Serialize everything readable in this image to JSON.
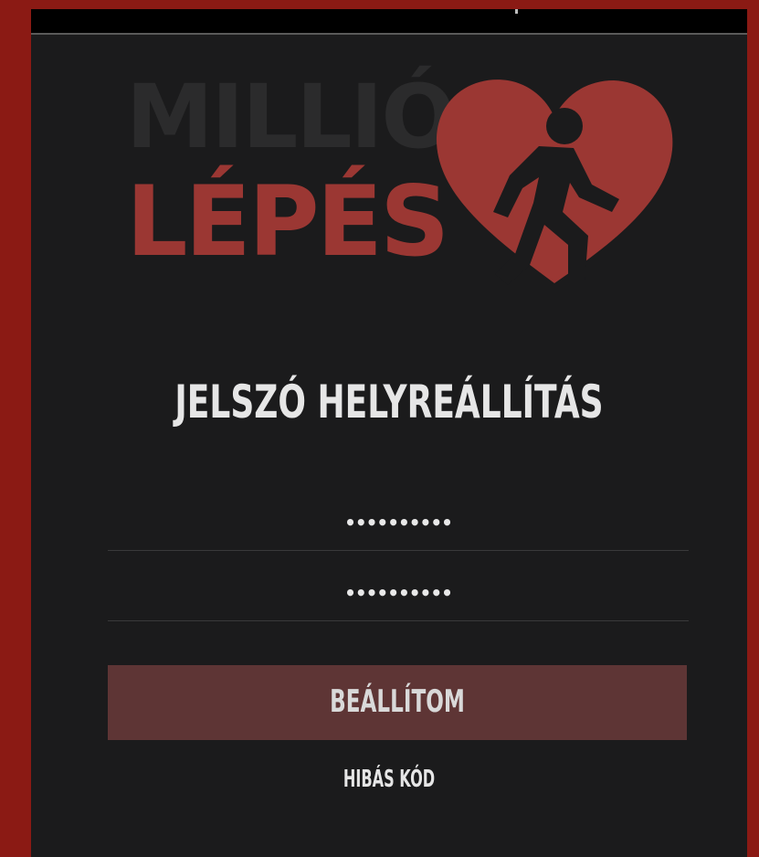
{
  "logo": {
    "line1": "MILLIÓ",
    "line2": "LÉPÉS",
    "icon": "heart-walking-person-icon"
  },
  "form": {
    "title": "JELSZÓ HELYREÁLLÍTÁS",
    "password_value": "••••••••••",
    "password_confirm_value": "••••••••••",
    "submit_label": "BEÁLLÍTOM",
    "error_link_label": "HIBÁS KÓD"
  },
  "colors": {
    "frame": "#8b1a14",
    "background": "#1b1b1c",
    "accent_red": "#9b3733",
    "button": "#5e3535",
    "text": "#e6e6e6"
  }
}
